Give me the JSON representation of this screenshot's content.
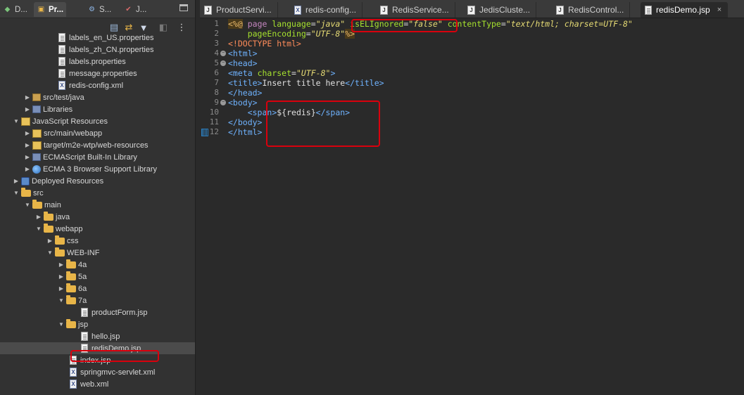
{
  "left_tabs": [
    {
      "label": "D...",
      "icon": "package-explorer-icon"
    },
    {
      "label": "Pr...",
      "icon": "project-explorer-icon"
    },
    {
      "label": "S...",
      "icon": "servers-icon"
    },
    {
      "label": "J...",
      "icon": "junit-icon"
    }
  ],
  "tree": [
    {
      "label": "labels_en_US.properties",
      "icon": "file",
      "indent": 80
    },
    {
      "label": "labels_zh_CN.properties",
      "icon": "file",
      "indent": 80
    },
    {
      "label": "labels.properties",
      "icon": "file",
      "indent": 80
    },
    {
      "label": "message.properties",
      "icon": "file",
      "indent": 80
    },
    {
      "label": "redis-config.xml",
      "icon": "xml",
      "indent": 80
    },
    {
      "label": "src/test/java",
      "icon": "pkg",
      "indent": 34,
      "arrow": "right"
    },
    {
      "label": "Libraries",
      "icon": "lib",
      "indent": 34,
      "arrow": "right"
    },
    {
      "label": "JavaScript Resources",
      "icon": "js",
      "indent": 18,
      "arrow": "down"
    },
    {
      "label": "src/main/webapp",
      "icon": "js",
      "indent": 34,
      "arrow": "right"
    },
    {
      "label": "target/m2e-wtp/web-resources",
      "icon": "js",
      "indent": 34,
      "arrow": "right"
    },
    {
      "label": "ECMAScript Built-In Library",
      "icon": "lib",
      "indent": 34,
      "arrow": "right"
    },
    {
      "label": "ECMA 3 Browser Support Library",
      "icon": "globe",
      "indent": 34,
      "arrow": "right"
    },
    {
      "label": "Deployed Resources",
      "icon": "deploy",
      "indent": 18,
      "arrow": "right"
    },
    {
      "label": "src",
      "icon": "folder",
      "indent": 18,
      "arrow": "down"
    },
    {
      "label": "main",
      "icon": "folder",
      "indent": 34,
      "arrow": "down"
    },
    {
      "label": "java",
      "icon": "folder",
      "indent": 50,
      "arrow": "right"
    },
    {
      "label": "webapp",
      "icon": "folder",
      "indent": 50,
      "arrow": "down"
    },
    {
      "label": "css",
      "icon": "folder",
      "indent": 66,
      "arrow": "right"
    },
    {
      "label": "WEB-INF",
      "icon": "folder",
      "indent": 66,
      "arrow": "down"
    },
    {
      "label": "4a",
      "icon": "folder",
      "indent": 82,
      "arrow": "right"
    },
    {
      "label": "5a",
      "icon": "folder",
      "indent": 82,
      "arrow": "right"
    },
    {
      "label": "6a",
      "icon": "folder",
      "indent": 82,
      "arrow": "right"
    },
    {
      "label": "7a",
      "icon": "folder",
      "indent": 82,
      "arrow": "down"
    },
    {
      "label": "productForm.jsp",
      "icon": "file",
      "indent": 112
    },
    {
      "label": "jsp",
      "icon": "folder",
      "indent": 82,
      "arrow": "down"
    },
    {
      "label": "hello.jsp",
      "icon": "file",
      "indent": 112
    },
    {
      "label": "redisDemo.jsp",
      "icon": "file",
      "indent": 112,
      "selected": true
    },
    {
      "label": "index.jsp",
      "icon": "file",
      "indent": 96
    },
    {
      "label": "springmvc-servlet.xml",
      "icon": "xml",
      "indent": 96
    },
    {
      "label": "web.xml",
      "icon": "xml",
      "indent": 96
    }
  ],
  "editor_tabs": [
    {
      "label": "ProductServi...",
      "icon": "java"
    },
    {
      "label": "redis-config...",
      "icon": "xml"
    },
    {
      "label": "RedisService...",
      "icon": "java"
    },
    {
      "label": "JedisCluste...",
      "icon": "java"
    },
    {
      "label": "RedisControl...",
      "icon": "java"
    },
    {
      "label": "redisDemo.jsp",
      "icon": "file",
      "active": true,
      "close": "×"
    }
  ],
  "line_numbers": [
    "1",
    "2",
    "3",
    "4",
    "5",
    "6",
    "7",
    "8",
    "9",
    "10",
    "11",
    "12"
  ],
  "code": {
    "l1_dir_open": "<%@",
    "l1_page": "page",
    "l1_lang": "language",
    "l1_eq": "=",
    "l1_lang_val": "\"java\"",
    "l1_el": "isELIgnored",
    "l1_el_val": "\"false\"",
    "l1_ct": "contentType",
    "l1_ct_val": "\"text/html; charset=UTF-8\"",
    "l2_pe": "pageEncoding",
    "l2_pe_val": "\"UTF-8\"",
    "l2_close": "%>",
    "l3": "<!DOCTYPE html>",
    "l4": "<html>",
    "l5": "<head>",
    "l6_open": "<meta",
    "l6_attr": "charset",
    "l6_val": "\"UTF-8\"",
    "l6_close": ">",
    "l7_open": "<title>",
    "l7_text": "Insert title here",
    "l7_close": "</title>",
    "l8": "</head>",
    "l9": "<body>",
    "l10_open": "<span>",
    "l10_text": "${redis}",
    "l10_close": "</span>",
    "l11": "</body>",
    "l12": "</html>"
  }
}
